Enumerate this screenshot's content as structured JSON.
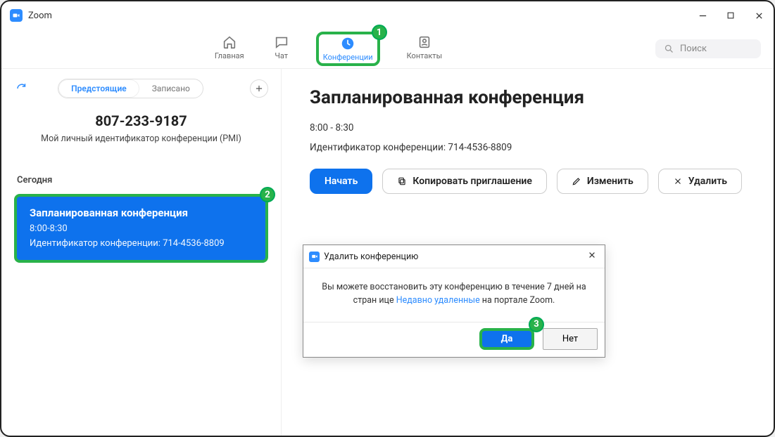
{
  "window": {
    "title": "Zoom"
  },
  "nav": {
    "home": "Главная",
    "chat": "Чат",
    "meetings": "Конференции",
    "contacts": "Контакты"
  },
  "search": {
    "placeholder": "Поиск"
  },
  "sidebar": {
    "tab_upcoming": "Предстоящие",
    "tab_recorded": "Записано",
    "pmi_number": "807-233-9187",
    "pmi_label": "Мой личный идентификатор конференции (PMI)",
    "section_today": "Сегодня",
    "meeting": {
      "title": "Запланированная конференция",
      "time": "8:00-8:30",
      "id_line": "Идентификатор конференции: 714-4536-8809"
    }
  },
  "main": {
    "title": "Запланированная конференция",
    "time": "8:00 - 8:30",
    "id_line": "Идентификатор конференции: 714-4536-8809",
    "btn_start": "Начать",
    "btn_copy": "Копировать приглашение",
    "btn_edit": "Изменить",
    "btn_delete": "Удалить"
  },
  "dialog": {
    "title": "Удалить конференцию",
    "body_pre": "Вы можете восстановить эту конференцию в течение 7 дней на стран ице ",
    "body_link": "Недавно удаленные",
    "body_post": " на портале Zoom.",
    "btn_yes": "Да",
    "btn_no": "Нет"
  },
  "callouts": {
    "c1": "1",
    "c2": "2",
    "c3": "3"
  }
}
